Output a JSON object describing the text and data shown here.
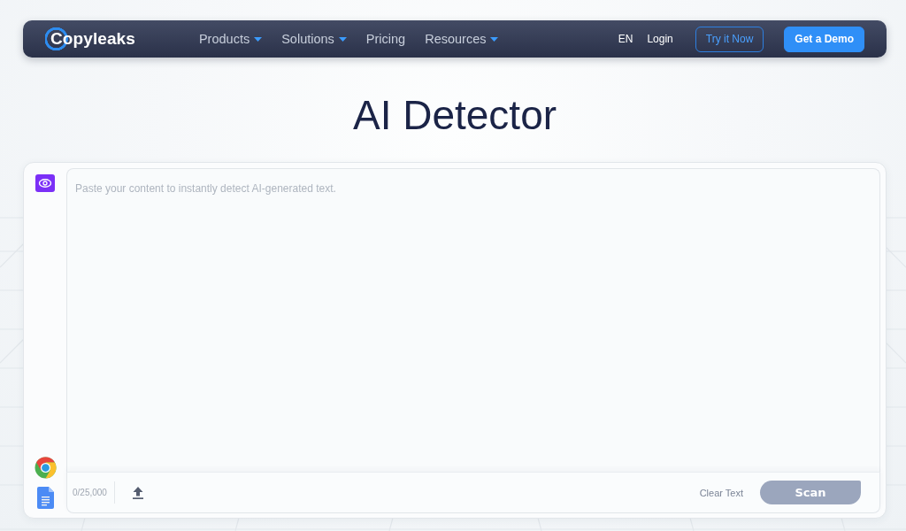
{
  "nav": {
    "logo": "Copyleaks",
    "links": [
      {
        "label": "Products",
        "dropdown": true
      },
      {
        "label": "Solutions",
        "dropdown": true
      },
      {
        "label": "Pricing",
        "dropdown": false
      },
      {
        "label": "Resources",
        "dropdown": true
      }
    ],
    "language": "EN",
    "login": "Login",
    "buttons": [
      {
        "label": "Try it Now",
        "kind": "outline"
      },
      {
        "label": "Get a Demo",
        "kind": "primary"
      }
    ]
  },
  "title": "AI Detector",
  "editor": {
    "placeholder": "Paste your content to instantly detect AI-generated text.",
    "counter": "0/25,000",
    "clear_label": "Clear Text",
    "scan": {
      "label": "Scan",
      "disabled": true
    }
  }
}
